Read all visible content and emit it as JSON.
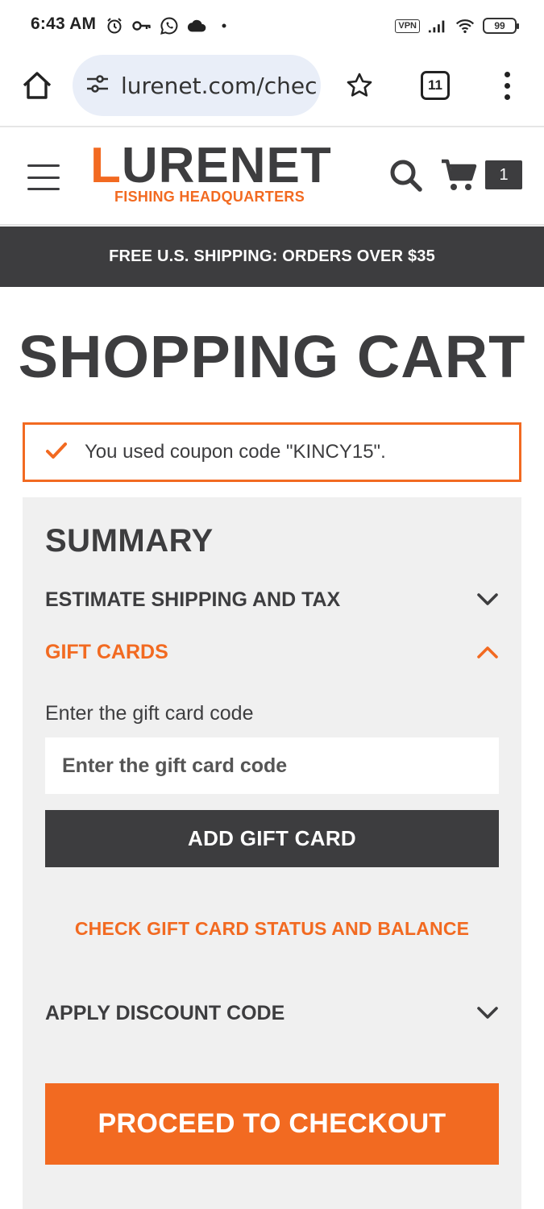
{
  "status_bar": {
    "time": "6:43 AM",
    "vpn": "VPN",
    "battery": "99"
  },
  "browser": {
    "url": "lurenet.com/chec",
    "tab_count": "11"
  },
  "header": {
    "logo_word_bolt": "L",
    "logo_word_rest": "URENET",
    "logo_tagline": "FISHING HEADQUARTERS",
    "cart_count": "1"
  },
  "promo": {
    "text": "FREE U.S. SHIPPING: ORDERS OVER $35"
  },
  "page": {
    "title": "SHOPPING CART"
  },
  "coupon": {
    "message": "You used coupon code \"KINCY15\"."
  },
  "summary": {
    "title": "SUMMARY",
    "estimate_shipping_label": "ESTIMATE SHIPPING AND TAX",
    "gift_cards_label": "GIFT CARDS",
    "gift_card_field_label": "Enter the gift card code",
    "gift_card_placeholder": "Enter the gift card code",
    "add_gift_card_label": "ADD GIFT CARD",
    "check_gift_card_label": "CHECK GIFT CARD STATUS AND BALANCE",
    "apply_discount_label": "APPLY DISCOUNT CODE",
    "checkout_label": "PROCEED TO CHECKOUT"
  },
  "colors": {
    "accent": "#f26a21",
    "dark": "#3d3d3f",
    "panel": "#f0f0f0",
    "url_pill": "#e9eef8"
  },
  "icons": {
    "status_left": [
      "alarm-icon",
      "key-icon",
      "whatsapp-icon",
      "cloud-icon",
      "dot-icon"
    ],
    "status_right": [
      "vpn-icon",
      "signal-icon",
      "wifi-icon",
      "battery-icon"
    ],
    "browser": [
      "home-icon",
      "site-settings-icon",
      "star-icon",
      "tabs-icon",
      "more-menu-icon"
    ],
    "header": [
      "menu-icon",
      "search-icon",
      "cart-icon"
    ],
    "coupon": "checkmark-icon",
    "accordion": [
      "chevron-down-icon",
      "chevron-up-icon",
      "chevron-down-icon"
    ]
  }
}
